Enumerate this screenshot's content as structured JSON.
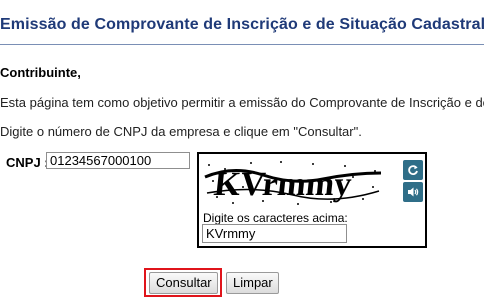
{
  "page": {
    "title": "Emissão de Comprovante de Inscrição e de Situação Cadastral",
    "greeting": "Contribuinte,",
    "paragraph1": "Esta página tem como objetivo permitir a emissão do Comprovante de Inscrição e de",
    "paragraph2": "Digite o número de CNPJ da empresa e clique em \"Consultar\"."
  },
  "form": {
    "cnpj_label": "CNPJ :",
    "cnpj_value": "01234567000100",
    "captcha": {
      "image_text": "KVrmmy",
      "prompt": "Digite os caracteres acima:",
      "input_value": "KVrmmy",
      "refresh_icon": "refresh-icon",
      "audio_icon": "speaker-icon"
    },
    "buttons": {
      "submit_label": "Consultar",
      "clear_label": "Limpar"
    }
  },
  "colors": {
    "title": "#1f3a78",
    "captcha_button": "#2f6e88",
    "focus_ring": "#e0141b"
  }
}
